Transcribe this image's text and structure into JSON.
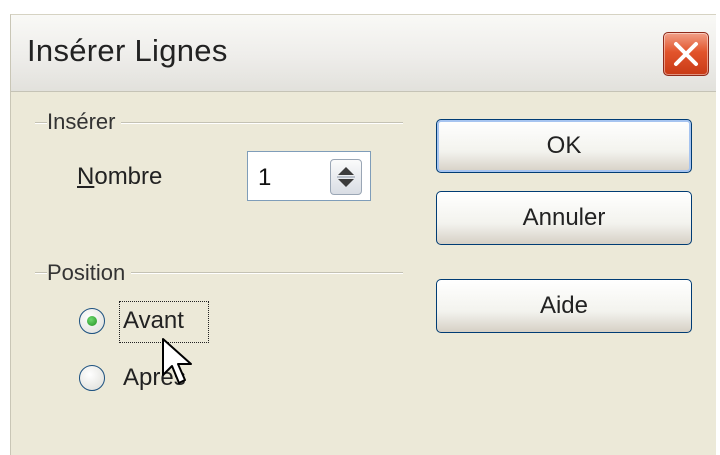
{
  "dialog": {
    "title": "Insérer Lignes",
    "close_icon": "close-x-icon"
  },
  "insert_group": {
    "label": "Insérer",
    "count_label_mnemonic": "N",
    "count_label_rest": "ombre",
    "count_value": "1"
  },
  "position_group": {
    "label": "Position",
    "options": [
      {
        "label": "Avant",
        "selected": true
      },
      {
        "label": "Après",
        "selected": false
      }
    ]
  },
  "buttons": {
    "ok": "OK",
    "cancel": "Annuler",
    "help": "Aide"
  },
  "colors": {
    "dialog_bg": "#ece9d8",
    "button_border": "#003c74",
    "close_button": "#d9522c",
    "radio_selected": "#21a121"
  }
}
